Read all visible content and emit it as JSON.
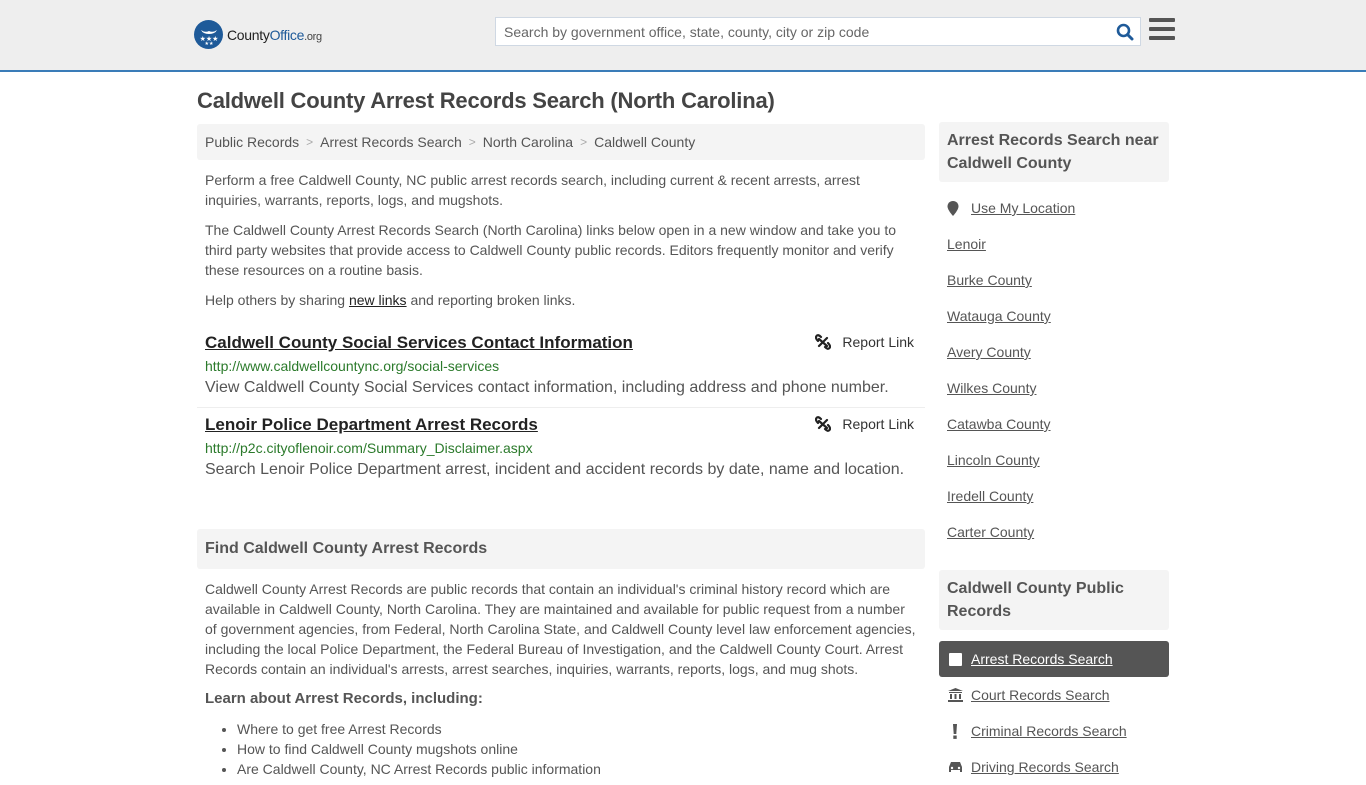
{
  "header": {
    "logo": {
      "part1": "County",
      "part2": "Office",
      "part3": ".org"
    },
    "search": {
      "placeholder": "Search by government office, state, county, city or zip code",
      "value": ""
    },
    "colors": {
      "brand": "#1e5a99",
      "accent_border": "#3a7cb8"
    }
  },
  "page": {
    "title": "Caldwell County Arrest Records Search (North Carolina)"
  },
  "breadcrumb": [
    {
      "label": "Public Records"
    },
    {
      "label": "Arrest Records Search"
    },
    {
      "label": "North Carolina"
    },
    {
      "label": "Caldwell County"
    }
  ],
  "intro": {
    "p1": "Perform a free Caldwell County, NC public arrest records search, including current & recent arrests, arrest inquiries, warrants, reports, logs, and mugshots.",
    "p2": "The Caldwell County Arrest Records Search (North Carolina) links below open in a new window and take you to third party websites that provide access to Caldwell County public records. Editors frequently monitor and verify these resources on a routine basis.",
    "p3_before": "Help others by sharing ",
    "p3_link": "new links",
    "p3_after": " and reporting broken links."
  },
  "results": [
    {
      "title": "Caldwell County Social Services Contact Information",
      "url": "http://www.caldwellcountync.org/social-services",
      "description": "View Caldwell County Social Services contact information, including address and phone number.",
      "report_label": "Report Link"
    },
    {
      "title": "Lenoir Police Department Arrest Records",
      "url": "http://p2c.cityoflenoir.com/Summary_Disclaimer.aspx",
      "description": "Search Lenoir Police Department arrest, incident and accident records by date, name and location.",
      "report_label": "Report Link"
    }
  ],
  "find_section": {
    "title": "Find Caldwell County Arrest Records",
    "body": "Caldwell County Arrest Records are public records that contain an individual's criminal history record which are available in Caldwell County, North Carolina. They are maintained and available for public request from a number of government agencies, from Federal, North Carolina State, and Caldwell County level law enforcement agencies, including the local Police Department, the Federal Bureau of Investigation, and the Caldwell County Court. Arrest Records contain an individual's arrests, arrest searches, inquiries, warrants, reports, logs, and mug shots.",
    "learn_title": "Learn about Arrest Records, including:",
    "learn_items": [
      "Where to get free Arrest Records",
      "How to find Caldwell County mugshots online",
      "Are Caldwell County, NC Arrest Records public information"
    ]
  },
  "sidebar": {
    "nearby_title": "Arrest Records Search near Caldwell County",
    "use_location": "Use My Location",
    "nearby": [
      "Lenoir",
      "Burke County",
      "Watauga County",
      "Avery County",
      "Wilkes County",
      "Catawba County",
      "Lincoln County",
      "Iredell County",
      "Carter County"
    ],
    "public_records_title": "Caldwell County Public Records",
    "public_records": [
      {
        "label": "Arrest Records Search",
        "icon": "square-icon",
        "active": true
      },
      {
        "label": "Court Records Search",
        "icon": "courthouse-icon",
        "active": false
      },
      {
        "label": "Criminal Records Search",
        "icon": "exclamation-icon",
        "active": false
      },
      {
        "label": "Driving Records Search",
        "icon": "car-icon",
        "active": false
      }
    ]
  }
}
